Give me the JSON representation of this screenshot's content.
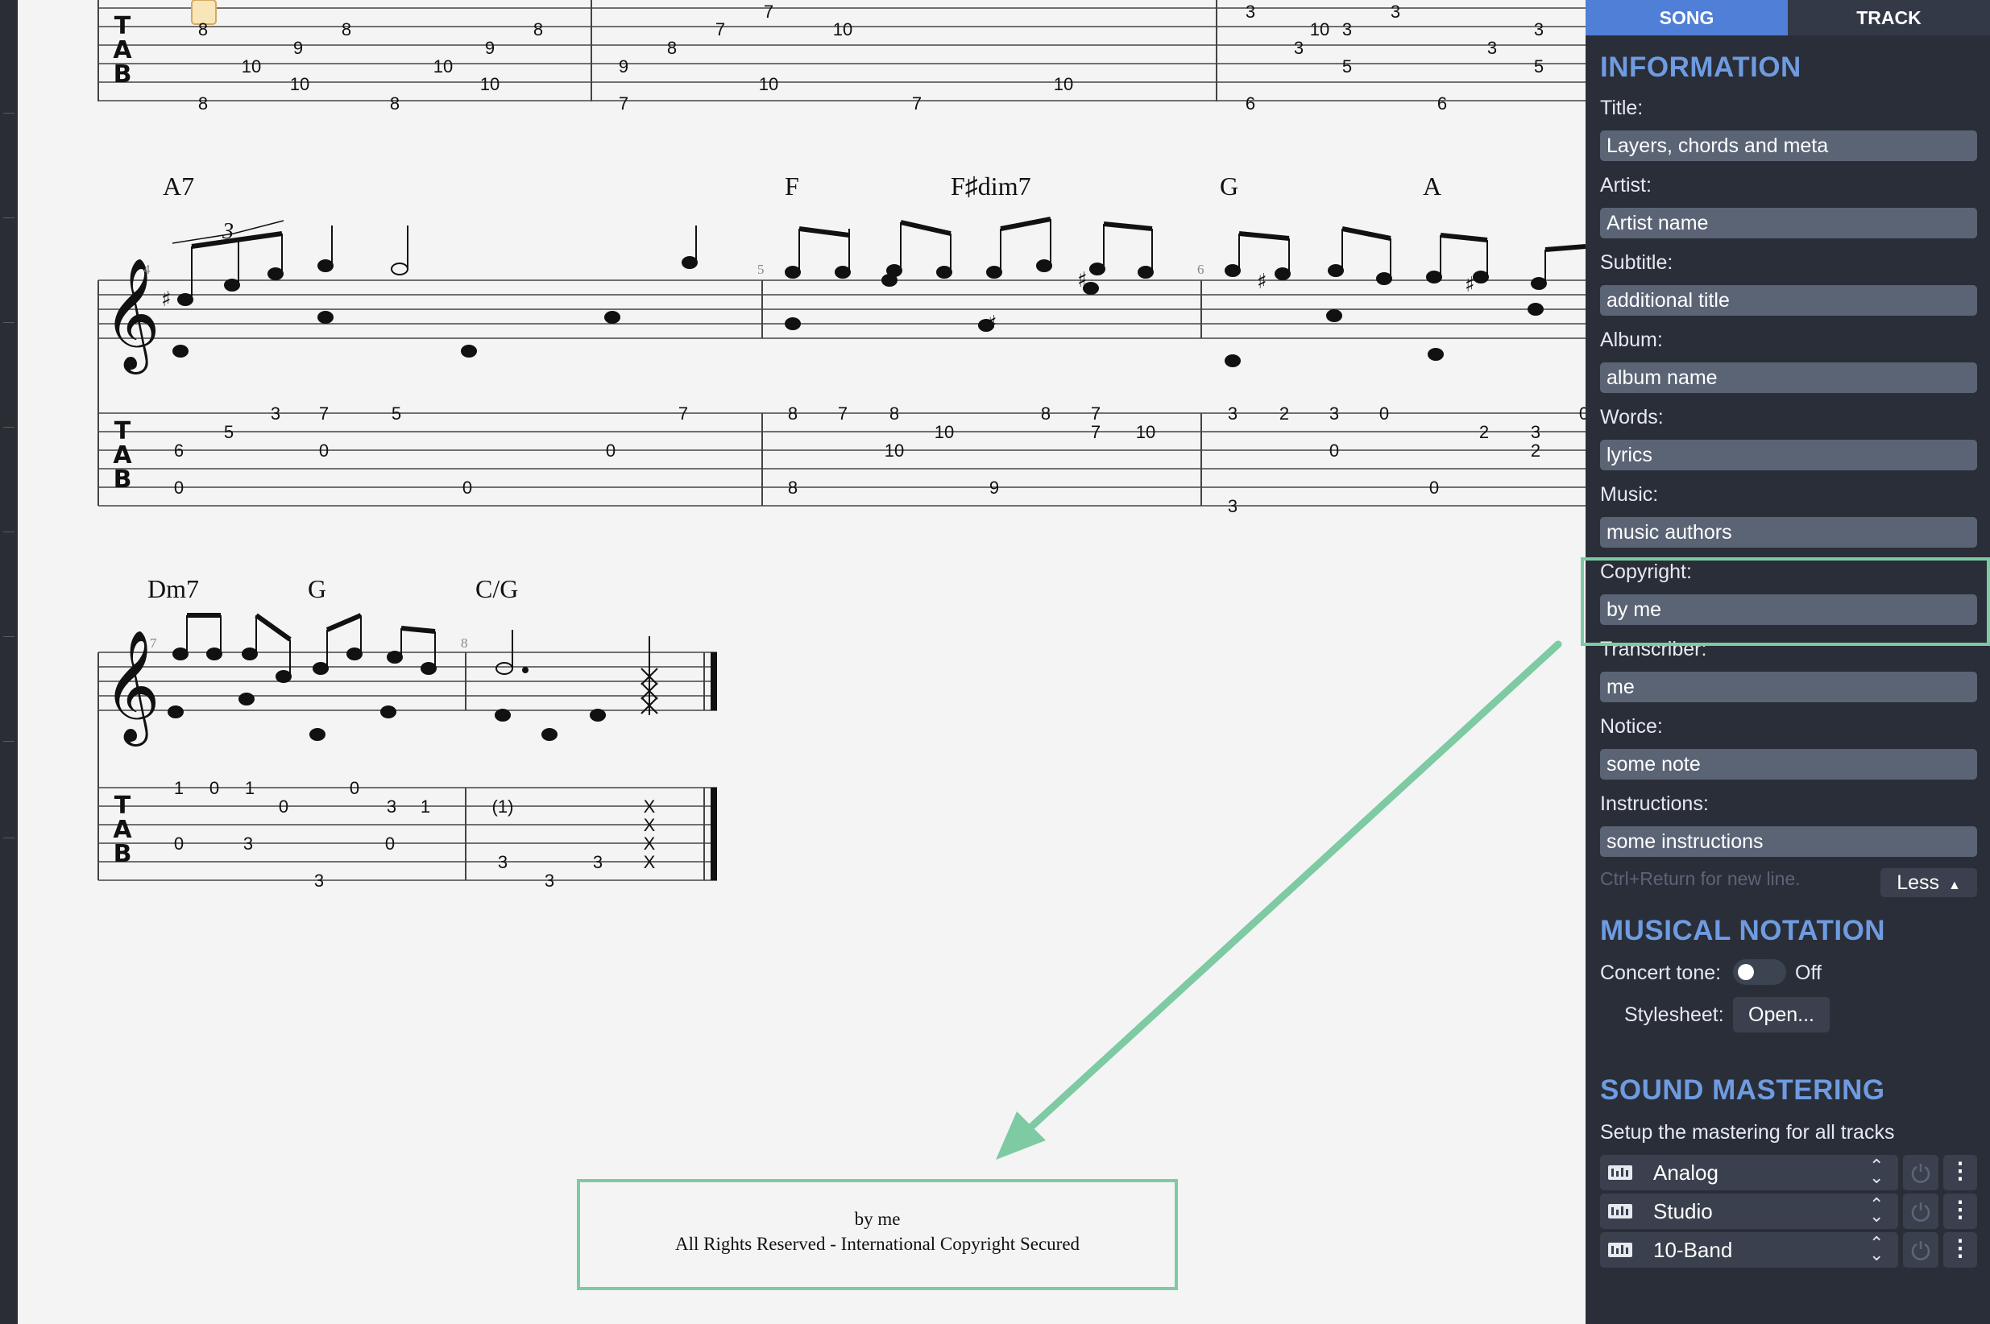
{
  "score": {
    "systems": [
      {
        "chords": [],
        "tab_numbers": [
          "8",
          "9",
          "8",
          "9",
          "8",
          "10",
          "10",
          "10",
          "10",
          "8",
          "8",
          "7",
          "7",
          "10",
          "8",
          "9",
          "10",
          "10",
          "7",
          "7",
          "10",
          "3",
          "3",
          "3",
          "3",
          "3",
          "3",
          "5",
          "5",
          "6",
          "6"
        ]
      },
      {
        "measure_numbers": [
          "4",
          "5",
          "6"
        ],
        "chords": [
          "A7",
          "F",
          "F♯dim7",
          "G",
          "A"
        ],
        "tuplet": "3",
        "tab_numbers": [
          "3",
          "7",
          "5",
          "5",
          "6",
          "0",
          "0",
          "0",
          "0",
          "7",
          "8",
          "7",
          "8",
          "10",
          "10",
          "8",
          "7",
          "7",
          "10",
          "8",
          "9",
          "3",
          "2",
          "3",
          "0",
          "0",
          "2",
          "3",
          "2",
          "0",
          "3",
          "0"
        ]
      },
      {
        "measure_numbers": [
          "7",
          "8"
        ],
        "chords": [
          "Dm7",
          "G",
          "C/G"
        ],
        "tab_numbers": [
          "1",
          "0",
          "1",
          "0",
          "0",
          "3",
          "3",
          "0",
          "0",
          "3",
          "1",
          "(1)",
          "3",
          "3",
          "3",
          "X",
          "X",
          "X",
          "X"
        ]
      }
    ],
    "footer": {
      "line1": "by me",
      "line2": "All Rights Reserved - International Copyright Secured"
    }
  },
  "panel": {
    "tabs": [
      "SONG",
      "TRACK"
    ],
    "information": {
      "heading": "INFORMATION",
      "fields": [
        {
          "label": "Title:",
          "value": "Layers, chords and meta"
        },
        {
          "label": "Artist:",
          "value": "Artist name"
        },
        {
          "label": "Subtitle:",
          "value": "additional title"
        },
        {
          "label": "Album:",
          "value": "album name"
        },
        {
          "label": "Words:",
          "value": "lyrics"
        },
        {
          "label": "Music:",
          "value": "music authors"
        },
        {
          "label": "Copyright:",
          "value": "by me"
        },
        {
          "label": "Transcriber:",
          "value": "me"
        },
        {
          "label": "Notice:",
          "value": "some note"
        },
        {
          "label": "Instructions:",
          "value": "some instructions"
        }
      ],
      "hint": "Ctrl+Return for new line.",
      "less_button": "Less"
    },
    "musical_notation": {
      "heading": "MUSICAL NOTATION",
      "concert_tone_label": "Concert tone:",
      "concert_tone_state": "Off",
      "stylesheet_label": "Stylesheet:",
      "stylesheet_button": "Open..."
    },
    "sound_mastering": {
      "heading": "SOUND MASTERING",
      "description": "Setup the mastering for all tracks",
      "presets": [
        "Analog",
        "Studio",
        "10-Band"
      ]
    }
  },
  "colors": {
    "accent": "#4f7fd6",
    "section_heading": "#6f9be0",
    "highlight": "#7dcaa3",
    "panel_bg": "#2a2e38",
    "field_bg": "#5b6475"
  }
}
